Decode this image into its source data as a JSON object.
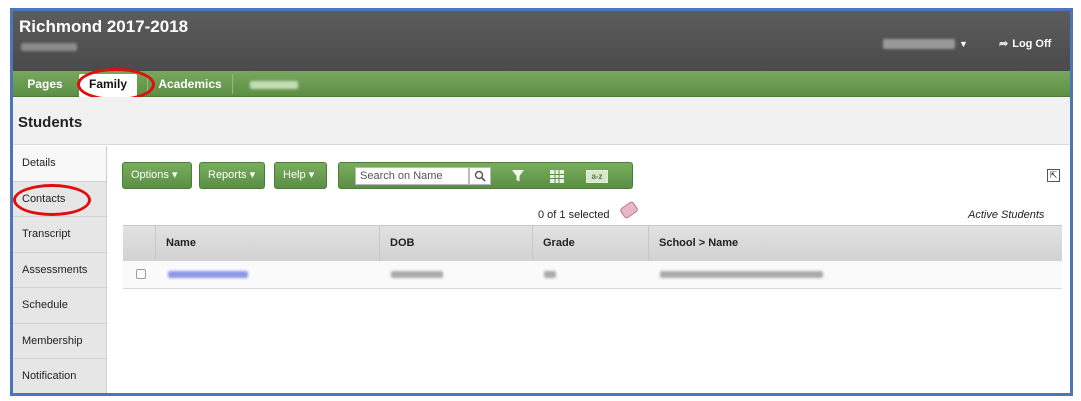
{
  "header": {
    "title": "Richmond 2017-2018",
    "logoff_label": "Log Off"
  },
  "tabs": {
    "pages": "Pages",
    "family": "Family",
    "academics": "Academics"
  },
  "page": {
    "title": "Students"
  },
  "sidebar": {
    "items": [
      {
        "label": "Details"
      },
      {
        "label": "Contacts"
      },
      {
        "label": "Transcript"
      },
      {
        "label": "Assessments"
      },
      {
        "label": "Schedule"
      },
      {
        "label": "Membership"
      },
      {
        "label": "Notification"
      }
    ]
  },
  "toolbar": {
    "options": "Options",
    "reports": "Reports",
    "help": "Help",
    "search_placeholder": "Search on Name",
    "sort_label": "a-z"
  },
  "list": {
    "selected_text": "0 of 1 selected",
    "filter_label": "Active Students",
    "columns": [
      "Name",
      "DOB",
      "Grade",
      "School > Name"
    ]
  },
  "annotations": {
    "highlight_color": "#e10e0e"
  }
}
